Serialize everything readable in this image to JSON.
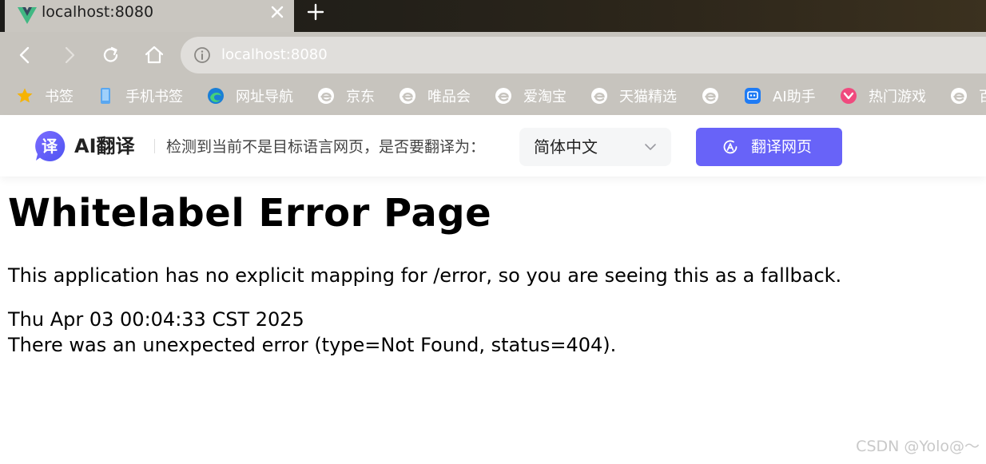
{
  "browser": {
    "tab": {
      "title": "localhost:8080",
      "favicon": "vue-logo-icon"
    },
    "address_bar": {
      "url": "localhost:8080"
    },
    "colors": {
      "tab_bg": "#c9c6c0",
      "toolbar_bg": "#c7c4be",
      "omnibox_bg": "#e0dedb"
    }
  },
  "bookmarks": [
    {
      "label": "书签",
      "icon": "star-icon"
    },
    {
      "label": "手机书签",
      "icon": "phone-icon"
    },
    {
      "label": "网址导航",
      "icon": "edge-browser-icon"
    },
    {
      "label": "京东",
      "icon": "e-logo-icon"
    },
    {
      "label": "唯品会",
      "icon": "e-logo-icon"
    },
    {
      "label": "爱淘宝",
      "icon": "e-logo-icon"
    },
    {
      "label": "天猫精选",
      "icon": "e-logo-icon"
    },
    {
      "label": "",
      "icon": "e-logo-icon"
    },
    {
      "label": "AI助手",
      "icon": "ai-assistant-icon"
    },
    {
      "label": "热门游戏",
      "icon": "game-icon"
    },
    {
      "label": "百",
      "icon": "e-logo-icon"
    }
  ],
  "translate_bar": {
    "logo_text": "译",
    "name": "AI翻译",
    "prompt": "检测到当前不是目标语言网页，是否要翻译为：",
    "target_language": "简体中文",
    "button_label": "翻译网页",
    "accent": "#6863f8"
  },
  "page": {
    "title": "Whitelabel Error Page",
    "message": "This application has no explicit mapping for /error, so you are seeing this as a fallback.",
    "timestamp": "Thu Apr 03 00:04:33 CST 2025",
    "error": "There was an unexpected error (type=Not Found, status=404)."
  },
  "watermark": "CSDN @Yolo@～"
}
